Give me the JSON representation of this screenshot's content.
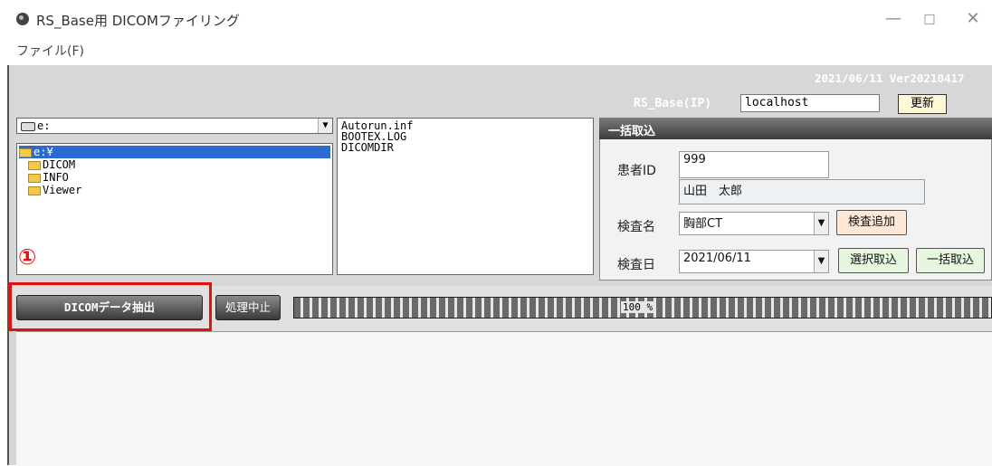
{
  "window": {
    "title": "RS_Base用 DICOMファイリング",
    "minimize_glyph": "—",
    "maximize_glyph": "□",
    "close_glyph": "✕"
  },
  "menu": {
    "file_label": "ファイル(F)"
  },
  "header": {
    "version": "2021/06/11 Ver20210417",
    "ip_label": "RS_Base(IP)",
    "ip_value": "localhost",
    "refresh_label": "更新"
  },
  "browser": {
    "drive_value": "e:",
    "tree": [
      {
        "label": "e:¥",
        "selected": true
      },
      {
        "label": "DICOM"
      },
      {
        "label": "INFO"
      },
      {
        "label": "Viewer"
      }
    ],
    "files": [
      "Autorun.inf",
      "BOOTEX.LOG",
      "DICOMDIR"
    ]
  },
  "batch_panel": {
    "title": "一括取込",
    "patient_id_label": "患者ID",
    "patient_id_value": "999",
    "patient_name_value": "山田　太郎",
    "exam_name_label": "検査名",
    "exam_name_value": "胸部CT",
    "add_exam_label": "検査追加",
    "exam_date_label": "検査日",
    "exam_date_value": "2021/06/11",
    "select_import_label": "選択取込",
    "batch_import_label": "一括取込"
  },
  "actions": {
    "step_marker": "①",
    "extract_label": "DICOMデータ抽出",
    "stop_label": "処理中止",
    "progress_text": "100 %",
    "progress_value": 100
  },
  "colors": {
    "highlight": "#e41010",
    "selection": "#2a6bd1",
    "refresh_bg": "#fff7d6",
    "add_exam_bg": "#fde8d8",
    "select_import_bg": "#e6f6df",
    "batch_import_bg": "#e6f6df"
  },
  "icons": {
    "app": "app-icon",
    "drive": "drive-icon",
    "folder": "folder-icon",
    "dropdown": "chevron-down-icon"
  }
}
